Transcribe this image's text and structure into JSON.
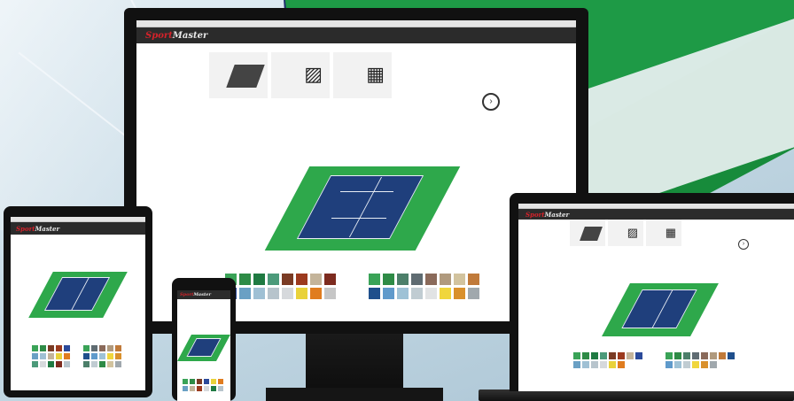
{
  "brand": {
    "name_part1": "Sport",
    "name_part2": "Master",
    "accent_color": "#d4222a"
  },
  "nav_links": [
    "",
    "",
    "",
    "",
    "",
    ""
  ],
  "steps": [
    {
      "icon": "court-icon",
      "title": "",
      "subtitle": ""
    },
    {
      "icon": "gallery-icon",
      "title": "",
      "subtitle": ""
    },
    {
      "icon": "calculator-icon",
      "title": "",
      "subtitle": ""
    },
    {
      "icon": "next-arrow-icon",
      "title": "",
      "subtitle": ""
    }
  ],
  "palette_court": [
    "#3aa357",
    "#2e8b46",
    "#1f7a42",
    "#4c9a7a",
    "#7a3b24",
    "#9c3a1e",
    "#c4b49a",
    "#7d2b1f",
    "#2b4a9a",
    "#6aa0c4",
    "#9fc0d4",
    "#b7c4cc",
    "#d6d9dc",
    "#e9d23a",
    "#e07c1f",
    "#c6c6c6"
  ],
  "palette_surround": [
    "#3aa357",
    "#2e8b46",
    "#4c7f6a",
    "#5f6c72",
    "#8a6a5a",
    "#b09a7e",
    "#d2c39e",
    "#c07a3a",
    "#1f4f8c",
    "#5f9acb",
    "#9ec2d6",
    "#c0ccd2",
    "#e1e3e4",
    "#f0d63c",
    "#d9902c",
    "#a0a8ad"
  ]
}
